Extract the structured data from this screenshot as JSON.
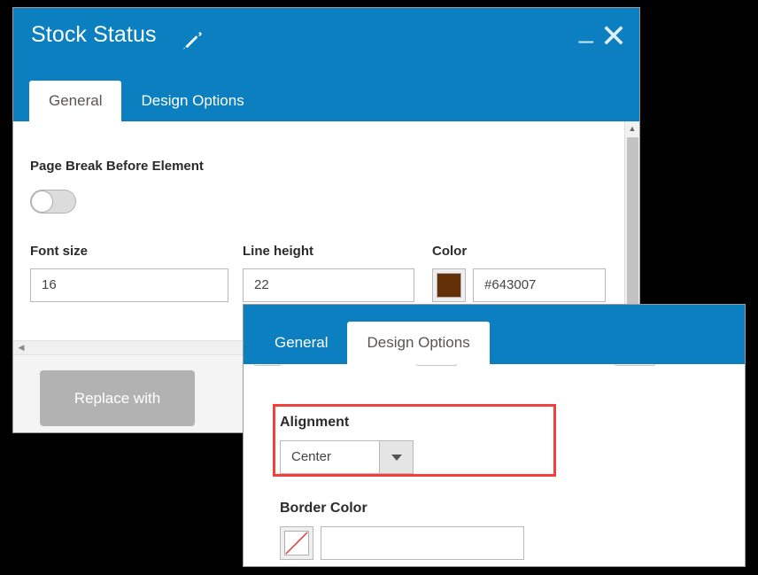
{
  "window_main": {
    "title": "Stock Status",
    "edit_icon": "pencil-icon",
    "minimize_label": "–",
    "close_label": "✕",
    "tabs": [
      {
        "label": "General",
        "active": true
      },
      {
        "label": "Design Options",
        "active": false
      }
    ],
    "fields": {
      "page_break": {
        "label": "Page Break Before Element",
        "toggle_state": "off"
      },
      "font_size": {
        "label": "Font size",
        "value": "16"
      },
      "line_height": {
        "label": "Line height",
        "value": "22"
      },
      "color": {
        "label": "Color",
        "value": "#643007",
        "swatch_hex": "#643007"
      }
    },
    "footer": {
      "replace_button": "Replace with"
    },
    "scrollbar": {
      "up_arrow_icon": "caret-up-icon",
      "left_arrow_icon": "caret-left-icon"
    }
  },
  "window_overlay": {
    "tabs": [
      {
        "label": "General",
        "active": false
      },
      {
        "label": "Design Options",
        "active": true
      }
    ],
    "fields": {
      "alignment": {
        "label": "Alignment",
        "value": "Center",
        "dropdown_icon": "chevron-down-icon"
      },
      "border_color": {
        "label": "Border Color",
        "value": "",
        "swatch_hex": "transparent",
        "swatch_icon": "no-color-icon"
      }
    },
    "highlight_color": "#f2413c"
  },
  "theme": {
    "titlebar_blue": "#0b7fbf",
    "tab_active_text": "#5a5550",
    "button_grey": "#b2b2b2"
  }
}
